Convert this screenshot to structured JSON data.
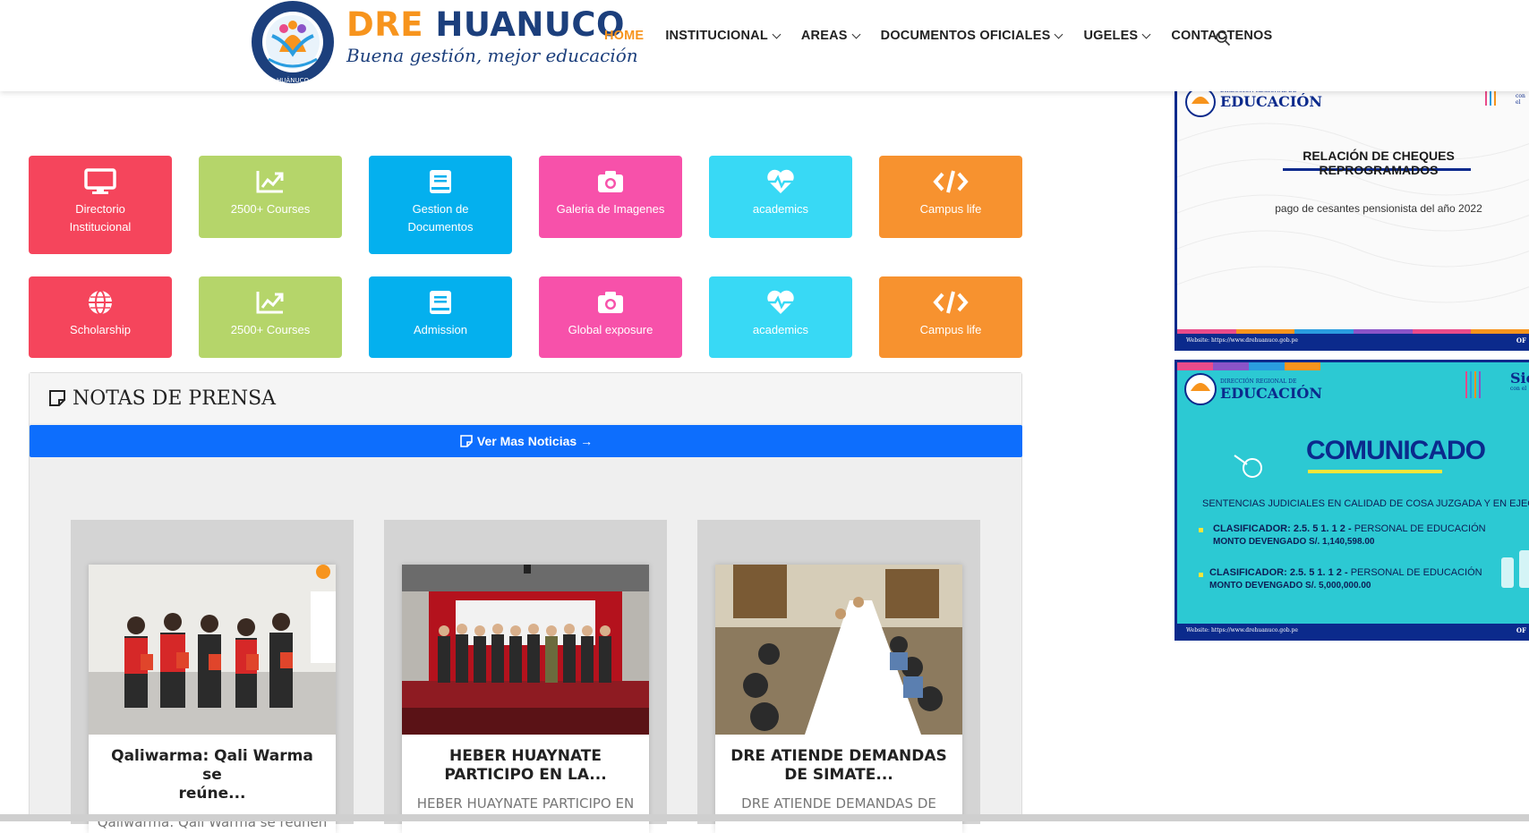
{
  "brand": {
    "title_part1": "DRE ",
    "title_part2": "HUANUCO",
    "slogan": "Buena gestión, mejor educación",
    "badge_ring_text": "DIRECCIÓN REGIONAL DE EDUCACIÓN",
    "badge_bottom_text": "HUÁNUCO"
  },
  "nav": {
    "items": [
      {
        "label": "HOME",
        "active": true
      },
      {
        "label": "INSTITUCIONAL",
        "dropdown": true
      },
      {
        "label": "AREAS",
        "dropdown": true
      },
      {
        "label": "DOCUMENTOS OFICIALES",
        "dropdown": true
      },
      {
        "label": "UGELES",
        "dropdown": true
      },
      {
        "label": "CONTACTENOS"
      }
    ],
    "search_icon": "search-icon"
  },
  "tiles": [
    {
      "label_lines": [
        "Directorio",
        "Institucional"
      ],
      "icon": "monitor-icon",
      "color": "#f5455c"
    },
    {
      "label_lines": [
        "2500+ Courses"
      ],
      "icon": "chart-icon",
      "color": "#b5d56a"
    },
    {
      "label_lines": [
        "Gestion de",
        "Documentos"
      ],
      "icon": "book-icon",
      "color": "#04b0ee"
    },
    {
      "label_lines": [
        "Galeria de Imagenes"
      ],
      "icon": "camera-icon",
      "color": "#f751aa"
    },
    {
      "label_lines": [
        "academics"
      ],
      "icon": "heartbeat-icon",
      "color": "#38d9f5"
    },
    {
      "label_lines": [
        "Campus life"
      ],
      "icon": "code-icon",
      "color": "#f7922f"
    },
    {
      "label_lines": [
        "Scholarship"
      ],
      "icon": "globe-icon",
      "color": "#f5455c"
    },
    {
      "label_lines": [
        "2500+ Courses"
      ],
      "icon": "chart-icon",
      "color": "#b5d56a"
    },
    {
      "label_lines": [
        "Admission"
      ],
      "icon": "book-icon",
      "color": "#04b0ee"
    },
    {
      "label_lines": [
        "Global exposure"
      ],
      "icon": "camera-icon",
      "color": "#f751aa"
    },
    {
      "label_lines": [
        "academics"
      ],
      "icon": "heartbeat-icon",
      "color": "#38d9f5"
    },
    {
      "label_lines": [
        "Campus life"
      ],
      "icon": "code-icon",
      "color": "#f7922f"
    }
  ],
  "news": {
    "heading": "NOTAS DE PRENSA",
    "more_label": "Ver Mas Noticias →",
    "cards": [
      {
        "title_line1": "Qaliwarma: Qali Warma se",
        "title_line2": "reúne...",
        "excerpt": "Qaliwarma: Qali Warma se reúnen"
      },
      {
        "title_line1": "HEBER HUAYNATE",
        "title_line2": "PARTICIPO EN LA...",
        "excerpt": "HEBER HUAYNATE PARTICIPO EN"
      },
      {
        "title_line1": "DRE ATIENDE DEMANDAS",
        "title_line2": "DE SIMATE...",
        "excerpt": "DRE ATIENDE DEMANDAS DE"
      }
    ]
  },
  "side_banners": {
    "banner1": {
      "org_small": "DIRECCIÓN REGIONAL DE",
      "org_big": "EDUCACIÓN",
      "title": "RELACIÓN DE CHEQUES REPROGRAMADOS",
      "subtitle": "pago de cesantes pensionista del año 2022",
      "website": "Website: https://www.drehuanuco.gob.pe",
      "tag_right": "con el",
      "edge_text": "OF"
    },
    "banner2": {
      "org_small": "DIRECCIÓN REGIONAL DE",
      "org_big": "EDUCACIÓN",
      "tag_right": "Sie",
      "tag_right_small": "con el",
      "title": "COMUNICADO",
      "subtitle": "SENTENCIAS JUDICIALES EN CALIDAD DE COSA JUZGADA Y EN EJECUCIÓ",
      "item1_label": "CLASIFICADOR: 2.5. 5 1. 1 2 -",
      "item1_rest": " PERSONAL DE EDUCACIÓN",
      "item1_amount": "MONTO DEVENGADO S/. 1,140,598.00",
      "item2_label": "CLASIFICADOR:  2.5. 5  1.  1  2 -",
      "item2_rest": " PERSONAL DE EDUCACIÓN",
      "item2_amount": "MONTO DEVENGADO S/. 5,000,000.00",
      "website": "Website: https://www.drehuanuco.gob.pe",
      "edge_text": "OF"
    }
  }
}
